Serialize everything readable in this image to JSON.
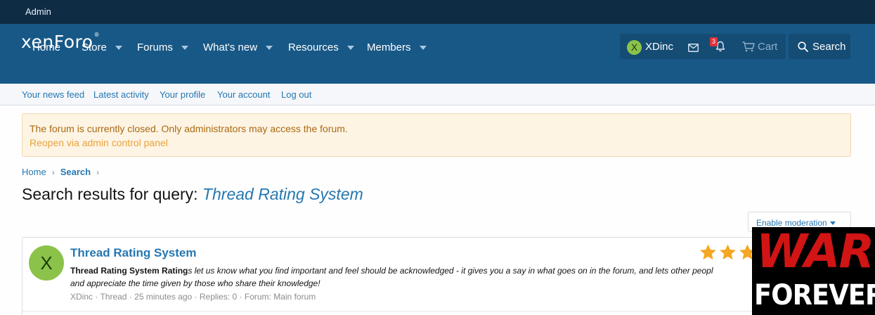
{
  "admin_bar": {
    "label": "Admin"
  },
  "header": {
    "logo": "xenForo",
    "nav": [
      "Home",
      "Store",
      "Forums",
      "What's new",
      "Resources",
      "Members"
    ],
    "user": {
      "avatar_letter": "X",
      "name": "XDinc"
    },
    "alerts_count": "3",
    "cart_label": "Cart",
    "search_label": "Search"
  },
  "subnav": [
    "Your news feed",
    "Latest activity",
    "Your profile",
    "Your account",
    "Log out"
  ],
  "notice": {
    "text": "The forum is currently closed. Only administrators may access the forum.",
    "link": "Reopen via admin control panel"
  },
  "breadcrumb": {
    "home": "Home",
    "current": "Search"
  },
  "page_title": {
    "prefix": "Search results for query:",
    "query": "Thread Rating System"
  },
  "moderation_button": "Enable moderation",
  "result": {
    "avatar_letter": "X",
    "title": "Thread Rating System",
    "snippet_bold": "Thread Rating System Rating",
    "snippet_rest": "s let us know what you find important and feel should be acknowledged - it gives you a say in what goes on in the forum, and lets other peopl",
    "snippet_line2": "and appreciate the time given by those who share their knowledge!",
    "meta": "XDinc · Thread · 25 minutes ago · Replies: 0 · Forum: Main forum",
    "star_color": "#f5a623"
  },
  "overlay_logo": {
    "top": "WAR",
    "bottom": "FOREVER"
  },
  "colors": {
    "header": "#185886",
    "admin_bar": "#0f2c45",
    "link": "#2577b1",
    "avatar": "#8bc34a",
    "badge": "#e0323a"
  }
}
